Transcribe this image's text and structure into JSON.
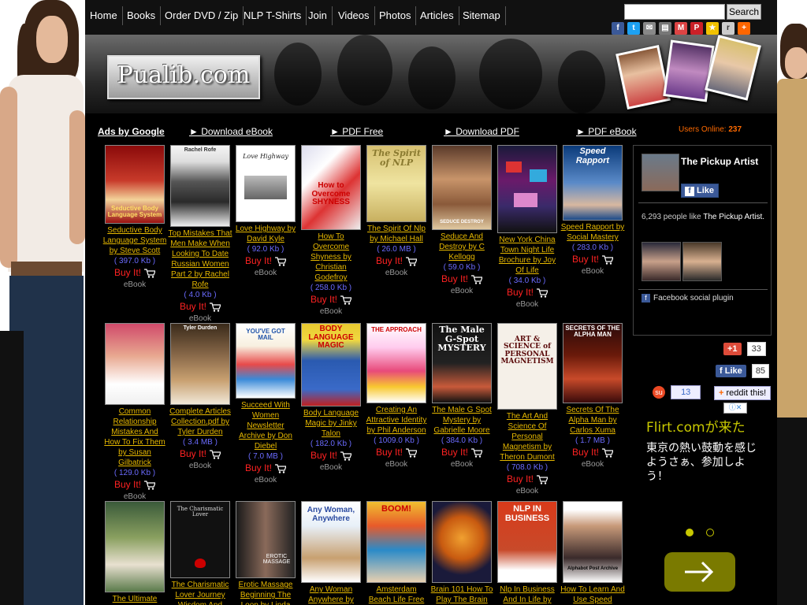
{
  "nav": {
    "items": [
      "Home",
      "Books",
      "Order DVD / Zip",
      "NLP T-Shirts",
      "Join",
      "Videos",
      "Photos",
      "Articles",
      "Sitemap"
    ],
    "search_placeholder": "",
    "search_button": "Search"
  },
  "share_icons": [
    "facebook-icon",
    "twitter-icon",
    "email-icon",
    "print-icon",
    "gmail-icon",
    "pinterest-icon",
    "favorites-icon",
    "reddit-icon",
    "more-share-icon"
  ],
  "banner": {
    "logo": "Pualib.com"
  },
  "ads": {
    "label": "Ads by Google",
    "links": [
      "► Download eBook",
      "► PDF Free",
      "► Download PDF",
      "► PDF eBook"
    ],
    "users_online_label": "Users Online: ",
    "users_online_count": "237"
  },
  "books": [
    {
      "title": "Seductive Body Language System by Steve Scott",
      "size": "( 397.0 Kb )",
      "cover_text": "Seductive Body Language System"
    },
    {
      "title": "Top Mistakes That Men Make When Looking To Date Russian Women Part 2 by Rachel Rofe",
      "size": "( 4.0 Kb )",
      "cover_text": "Rachel Rofe"
    },
    {
      "title": "Love Highway by David Kyle",
      "size": "( 92.0 Kb )",
      "cover_text": "Love Highway"
    },
    {
      "title": "How To Overcome Shyness by Christian Godefroy",
      "size": "( 258.0 Kb )",
      "cover_text": "How to Overcome SHYNESS"
    },
    {
      "title": "The Spirit Of Nlp by Michael Hall",
      "size": "( 26.0 MB )",
      "cover_text": "The Spirit of NLP"
    },
    {
      "title": "Seduce And Destroy by C Kellogg",
      "size": "( 59.0 Kb )",
      "cover_text": "SEDUCE DESTROY"
    },
    {
      "title": "New York China Town Night Life Brochure by Joy Of Life",
      "size": "( 34.0 Kb )",
      "cover_text": ""
    },
    {
      "title": "Speed Rapport by Social Mastery",
      "size": "( 283.0 Kb )",
      "cover_text": "Speed Rapport"
    },
    {
      "title": "Common Relationship Mistakes And How To Fix Them by Susan Gilbatrick",
      "size": "( 129.0 Kb )",
      "cover_text": ""
    },
    {
      "title": "Complete Articles Collection.pdf by Tyler Durden",
      "size": "( 3.4 MB )",
      "cover_text": "Tyler Durden"
    },
    {
      "title": "Succeed With Women Newsletter Archive by Don Diebel",
      "size": "( 7.0 MB )",
      "cover_text": "YOU'VE GOT MAIL"
    },
    {
      "title": "Body Language Magic by Jinky Talon",
      "size": "( 182.0 Kb )",
      "cover_text": "BODY LANGUAGE MAGIC"
    },
    {
      "title": "Creating An Attractive Identity by Phil Anderson",
      "size": "( 1009.0 Kb )",
      "cover_text": "THE APPROACH"
    },
    {
      "title": "The Male G Spot Mystery by Gabrielle Moore",
      "size": "( 384.0 Kb )",
      "cover_text": "The Male G-Spot MYSTERY"
    },
    {
      "title": "The Art And Science Of Personal Magnetism by Theron Dumont",
      "size": "( 708.0 Kb )",
      "cover_text": "ART & SCIENCE of PERSONAL MAGNETISM"
    },
    {
      "title": "Secrets Of The Alpha Man by Carlos Xuma",
      "size": "( 1.7 MB )",
      "cover_text": "SECRETS OF THE ALPHA MAN"
    },
    {
      "title": "The Ultimate",
      "size": "",
      "cover_text": ""
    },
    {
      "title": "The Charismatic Lover Journey Wisdom And",
      "size": "",
      "cover_text": "The Charismatic Lover"
    },
    {
      "title": "Erotic Massage Beginning The Loop by Linda",
      "size": "",
      "cover_text": "EROTIC MASSAGE"
    },
    {
      "title": "Any Woman Anywhere by",
      "size": "",
      "cover_text": "Any Woman, Anywhere"
    },
    {
      "title": "Amsterdam Beach Life Free",
      "size": "",
      "cover_text": "BOOM!"
    },
    {
      "title": "Brain 101 How To Play The Brain",
      "size": "",
      "cover_text": ""
    },
    {
      "title": "Nlp In Business And In Life by",
      "size": "",
      "cover_text": "NLP IN BUSINESS"
    },
    {
      "title": "How To Learn And Use Speed",
      "size": "",
      "cover_text": "Alphabot Post Archive"
    }
  ],
  "buy_label": "Buy It!",
  "ebook_label": "eBook",
  "facebook": {
    "page_name": "The Pickup Artist",
    "like_label": "Like",
    "count_text": "6,293 people like ",
    "count_page": "The Pickup Artist.",
    "plugin_label": "Facebook social plugin"
  },
  "social": {
    "gplus_label": "+1",
    "gplus_count": "33",
    "fb_like_label": "Like",
    "fb_like_count": "85",
    "stumble_count": "13",
    "reddit_label": "reddit this!"
  },
  "ad": {
    "title": "Flirt.comが来た",
    "body": "東京の熱い鼓動を感じようさぁ、参加しよう！"
  }
}
